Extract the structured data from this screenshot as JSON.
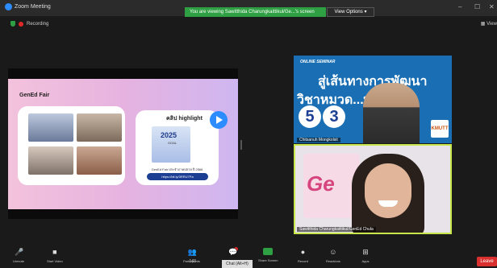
{
  "window": {
    "title": "Zoom Meeting",
    "banner": "You are viewing Sawitthida Charungkaittikul/Ge...'s screen",
    "view_options": "View Options",
    "minimize": "–",
    "maximize": "☐",
    "close": "✕"
  },
  "status": {
    "recording_label": "Recording",
    "view_label": "View"
  },
  "slide": {
    "title": "GenEd Fair",
    "highlight_title": "คลิป highlight",
    "thumb_logo": "2025",
    "thumb_sub": "GOAL",
    "caption": "GenEd Fair ประจำภาคปลาย ปี 2566",
    "link": "https://bit.ly/3RRU7Pa"
  },
  "participants": [
    {
      "name": "Chitsanuh Mongkolsit",
      "overlay_tag": "ONLINE SEMINAR",
      "overlay_line1": "สู่เส้นทางการพัฒนา",
      "overlay_line2": "วิชาหมวด...ษาทั่วไป",
      "num1": "5",
      "num2": "3",
      "logo": "KMUTT"
    },
    {
      "name": "Sawitthida Charungkaittikul/GenEd Chula",
      "bg_text": "Ge"
    }
  ],
  "toolbar": {
    "unmute": "Unmute",
    "start_video": "Start Video",
    "participants": "Participants",
    "participants_count": "143",
    "chat": "Chat (Alt+H)",
    "share": "Share Screen",
    "record": "Record",
    "reactions": "Reactions",
    "apps": "Apps",
    "leave": "Leave"
  },
  "colors": {
    "accent": "#2d8cff",
    "green": "#2ea043",
    "leave_red": "#d9302f"
  }
}
